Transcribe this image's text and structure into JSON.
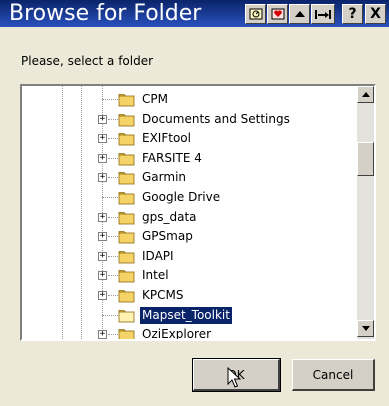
{
  "window": {
    "title": "Browse for Folder",
    "title_buttons": {
      "help": "?",
      "close": "X"
    }
  },
  "prompt": "Please, select a folder",
  "tree": {
    "items": [
      {
        "label": "CPM",
        "expandable": false,
        "selected": false
      },
      {
        "label": "Documents and Settings",
        "expandable": true,
        "selected": false
      },
      {
        "label": "EXIFtool",
        "expandable": true,
        "selected": false
      },
      {
        "label": "FARSITE 4",
        "expandable": true,
        "selected": false
      },
      {
        "label": "Garmin",
        "expandable": true,
        "selected": false
      },
      {
        "label": "Google Drive",
        "expandable": false,
        "selected": false
      },
      {
        "label": "gps_data",
        "expandable": true,
        "selected": false
      },
      {
        "label": "GPSmap",
        "expandable": true,
        "selected": false
      },
      {
        "label": "IDAPI",
        "expandable": true,
        "selected": false
      },
      {
        "label": "Intel",
        "expandable": true,
        "selected": false
      },
      {
        "label": "KPCMS",
        "expandable": true,
        "selected": false
      },
      {
        "label": "Mapset_Toolkit",
        "expandable": false,
        "selected": true
      },
      {
        "label": "OziExplorer",
        "expandable": true,
        "selected": false
      }
    ]
  },
  "buttons": {
    "ok": "OK",
    "cancel": "Cancel"
  },
  "colors": {
    "titlebar": "#0a246a",
    "face": "#d4d0c8",
    "selection": "#0a246a"
  }
}
